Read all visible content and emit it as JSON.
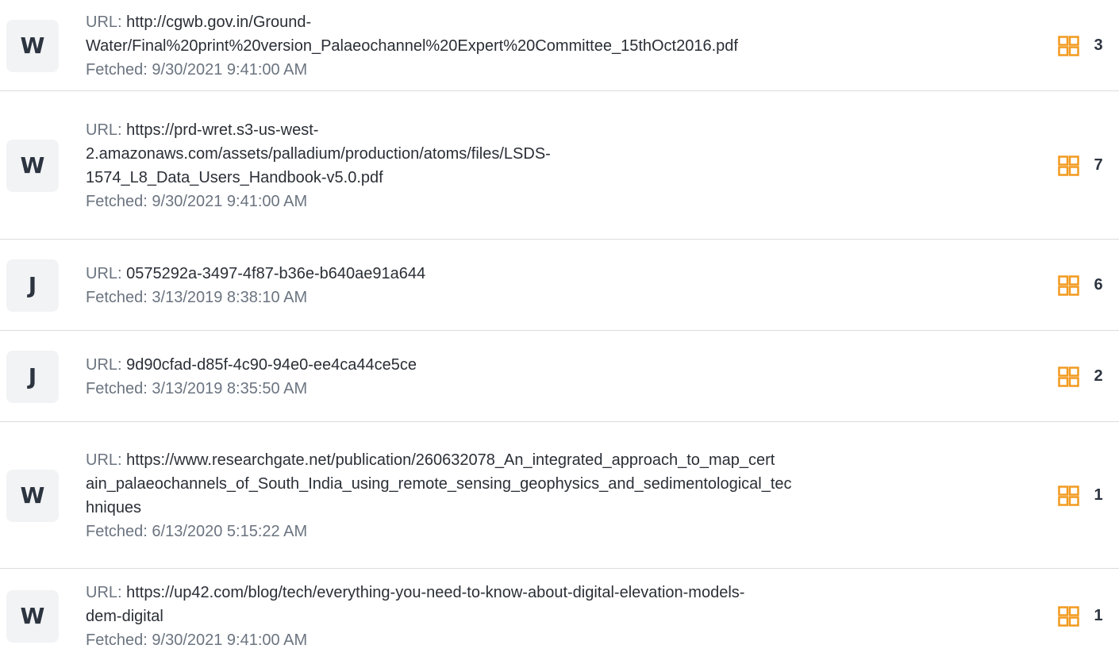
{
  "labels": {
    "url_prefix": "URL: ",
    "fetched_prefix": "Fetched: "
  },
  "icon": {
    "name": "grid-icon",
    "color": "#f29a1f"
  },
  "sources": [
    {
      "badge": "W",
      "url_lines": [
        "http://cgwb.gov.in/Ground-",
        "Water/Final%20print%20version_Palaeochannel%20Expert%20Committee_15thOct2016.pdf"
      ],
      "fetched": "9/30/2021 9:41:00 AM",
      "count": "3"
    },
    {
      "badge": "W",
      "url_lines": [
        "https://prd-wret.s3-us-west-",
        "2.amazonaws.com/assets/palladium/production/atoms/files/LSDS-",
        "1574_L8_Data_Users_Handbook-v5.0.pdf"
      ],
      "fetched": "9/30/2021 9:41:00 AM",
      "count": "7"
    },
    {
      "badge": "J",
      "url_lines": [
        "0575292a-3497-4f87-b36e-b640ae91a644"
      ],
      "fetched": "3/13/2019 8:38:10 AM",
      "count": "6"
    },
    {
      "badge": "J",
      "url_lines": [
        "9d90cfad-d85f-4c90-94e0-ee4ca44ce5ce"
      ],
      "fetched": "3/13/2019 8:35:50 AM",
      "count": "2"
    },
    {
      "badge": "W",
      "url_lines": [
        "https://www.researchgate.net/publication/260632078_An_integrated_approach_to_map_cert",
        "ain_palaeochannels_of_South_India_using_remote_sensing_geophysics_and_sedimentological_tec",
        "hniques"
      ],
      "fetched": "6/13/2020 5:15:22 AM",
      "count": "1"
    },
    {
      "badge": "W",
      "url_lines": [
        "https://up42.com/blog/tech/everything-you-need-to-know-about-digital-elevation-models-",
        "dem-digital"
      ],
      "fetched": "9/30/2021 9:41:00 AM",
      "count": "1"
    }
  ]
}
